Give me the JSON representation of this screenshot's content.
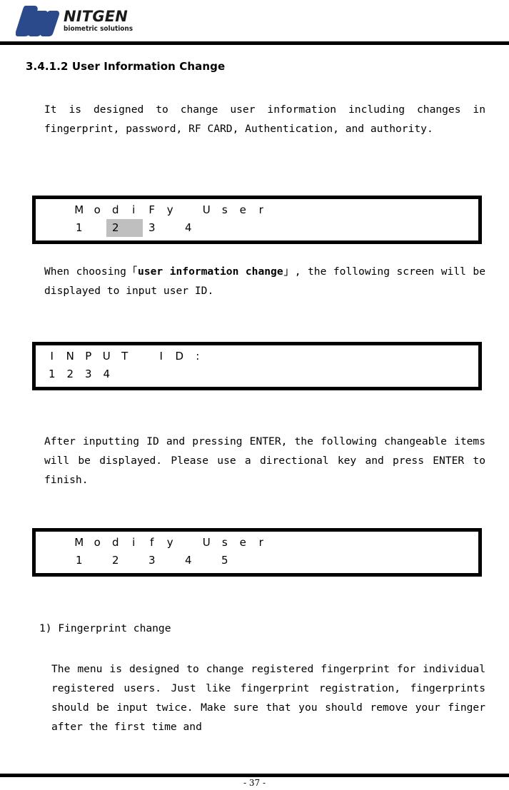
{
  "header": {
    "logo_wordmark": "NITGEN",
    "logo_tagline": "biometric solutions",
    "logo_color": "#2b4a8b"
  },
  "heading": "3.4.1.2 User Information Change",
  "paragraphs": {
    "intro": "It is designed to change user information including changes in fingerprint, password, RF CARD, Authentication, and authority.",
    "when_choosing_pre": "When choosing「",
    "when_choosing_bold": "user information change",
    "when_choosing_post": "」, the following screen will be displayed to input user ID.",
    "after_inputting": "After inputting ID and pressing ENTER, the following changeable items will be displayed. Please use a directional key and press ENTER to finish.",
    "list_item_1": "1) Fingerprint change",
    "fingerprint_body": "The menu is designed to change registered fingerprint for individual registered users. Just like fingerprint registration, fingerprints should be input twice. Make sure that you should remove your finger after the first time and"
  },
  "lcd_screens": [
    {
      "name": "modify-user-menu",
      "row1": [
        "M",
        "o",
        "d",
        "i",
        "F",
        "y",
        " ",
        "U",
        "s",
        "e",
        "r",
        " ",
        " ",
        " ",
        " ",
        " ",
        " ",
        " ",
        " ",
        " ",
        " ",
        " "
      ],
      "row2": [
        "1",
        " ",
        "2",
        " ",
        "3",
        " ",
        "4",
        " ",
        " ",
        " ",
        " ",
        " ",
        " ",
        " ",
        " ",
        " ",
        " ",
        " ",
        " ",
        " ",
        " ",
        " "
      ],
      "row2_highlight_index": 2,
      "highlight_color": "#bfbfbf"
    },
    {
      "name": "input-id-screen",
      "row1": [
        "I",
        "N",
        "P",
        "U",
        "T",
        " ",
        "I",
        "D",
        ":",
        " ",
        " ",
        " ",
        " ",
        " ",
        " ",
        " ",
        " ",
        " ",
        " ",
        " ",
        " ",
        " "
      ],
      "row2": [
        "1",
        "2",
        "3",
        "4",
        " ",
        " ",
        " ",
        " ",
        " ",
        " ",
        " ",
        " ",
        " ",
        " ",
        " ",
        " ",
        " ",
        " ",
        " ",
        " ",
        " ",
        " "
      ],
      "row2_highlight_index": null,
      "highlight_color": "#bfbfbf"
    },
    {
      "name": "modify-user-items",
      "row1": [
        "M",
        "o",
        "d",
        "i",
        "f",
        "y",
        " ",
        "U",
        "s",
        "e",
        "r",
        " ",
        " ",
        " ",
        " ",
        " ",
        " ",
        " ",
        " ",
        " ",
        " ",
        " "
      ],
      "row2": [
        "1",
        " ",
        "2",
        " ",
        "3",
        " ",
        "4",
        " ",
        "5",
        " ",
        " ",
        " ",
        " ",
        " ",
        " ",
        " ",
        " ",
        " ",
        " ",
        " ",
        " ",
        " "
      ],
      "row2_highlight_index": null,
      "highlight_color": "#bfbfbf"
    }
  ],
  "footer": {
    "page_number": "- 37 -"
  }
}
